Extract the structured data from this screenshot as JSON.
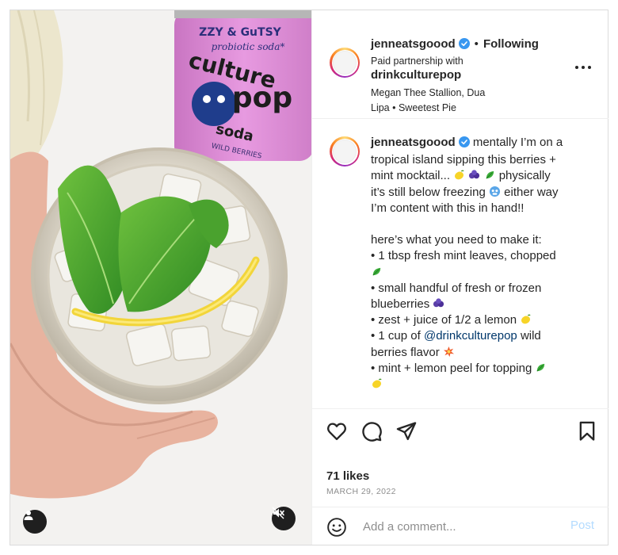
{
  "post": {
    "username": "jenneatsgoood",
    "follow_separator": "•",
    "follow_status": "Following",
    "paid_label": "Paid partnership with",
    "partner": "drinkculturepop",
    "music_line1": "Megan Thee Stallion, Dua",
    "music_line2": "Lipa • Sweetest Pie"
  },
  "media": {
    "can_brand_top": "ZZY & GuTSY",
    "can_sub": "probiotic soda*",
    "can_brand": "culture",
    "can_pop": "pop",
    "can_soda": "soda",
    "can_flavor": "WILD BERRIES"
  },
  "caption": {
    "username": "jenneatsgoood",
    "l1": "mentally I’m on a",
    "l2": "tropical island sipping this berries +",
    "l3": "mint mocktail...",
    "l4": "physically",
    "l5": "it’s still below freezing",
    "l6": "either way",
    "l7": "I’m content with this in hand!!",
    "l8": "here’s what you need to make it:",
    "l9": "• 1 tbsp fresh mint leaves, chopped",
    "l10": "• small handful of fresh or frozen",
    "l11": "blueberries",
    "l12": "• zest + juice of 1/2 a lemon",
    "l13a": "• 1 cup of",
    "l13b": "@drinkculturepop",
    "l13c": "wild",
    "l14": "berries flavor",
    "l15": "• mint + lemon peel for topping"
  },
  "icons": {
    "like": "heart-icon",
    "comment": "comment-icon",
    "share": "send-icon",
    "save": "bookmark-icon",
    "emoji": "smiley-icon",
    "more": "more-options-icon",
    "tag": "user-tag-icon",
    "mute": "muted-speaker-icon"
  },
  "stats": {
    "likes": "71 likes",
    "date": "MARCH 29, 2022"
  },
  "comment": {
    "placeholder": "Add a comment...",
    "post_label": "Post"
  },
  "colors": {
    "verified": "#3897f0",
    "link": "#00376b",
    "post_disabled": "#b3dbff",
    "can_pink": "#e48ad8"
  }
}
